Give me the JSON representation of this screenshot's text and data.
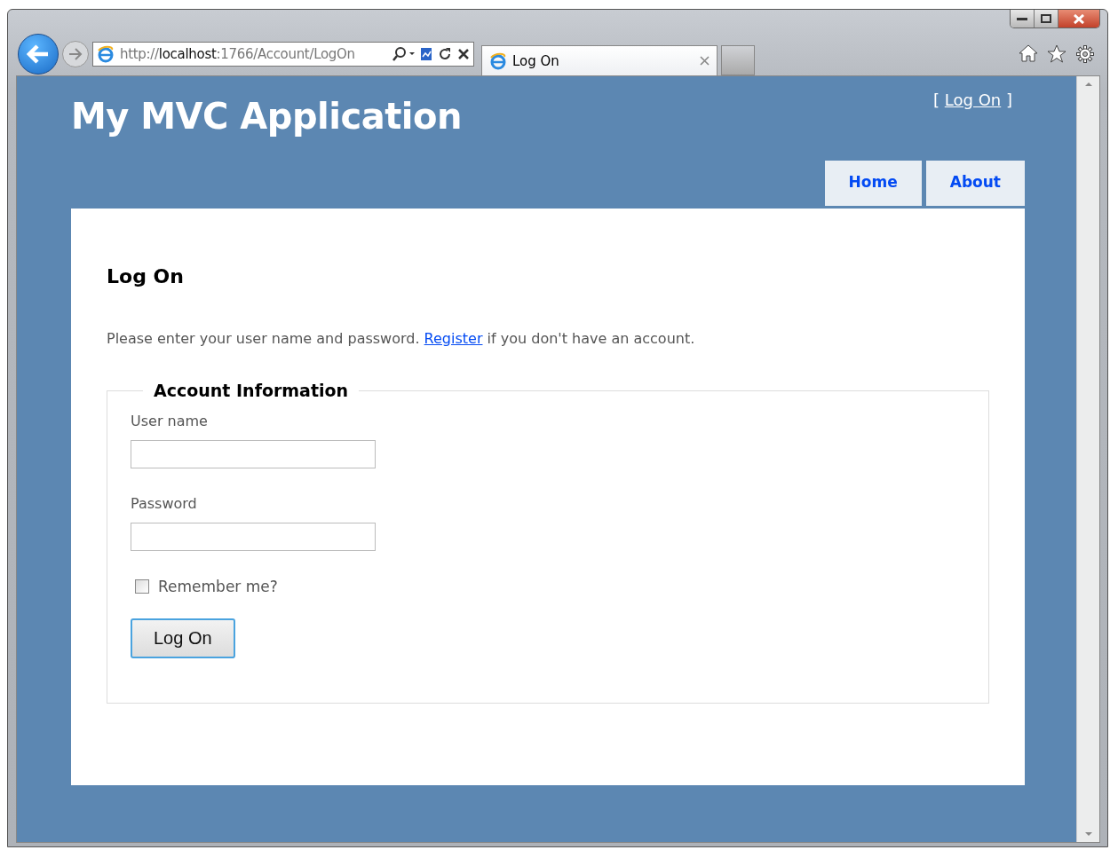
{
  "browser": {
    "address": "http://**localhost**:1766/Account/LogOn",
    "tab": {
      "title": "Log On",
      "selected": true
    }
  },
  "site": {
    "title": "My MVC Application",
    "login_link": {
      "before": "[",
      "link": "Log On",
      "after": "]"
    },
    "menu": [
      {
        "label": "Home",
        "selected": false
      },
      {
        "label": "About",
        "selected": false
      }
    ]
  },
  "page": {
    "heading": "Log On",
    "intro_before": "Please enter your user name and password.",
    "register_link": "Register",
    "intro_after": "if you don't have an account.",
    "fieldset": {
      "legend": "Account Information",
      "fields": [
        {
          "label": "User name"
        },
        {
          "label": "Password"
        }
      ],
      "remember": {
        "label": "Remember me?",
        "checked": false
      },
      "submit": "Log On"
    }
  }
}
